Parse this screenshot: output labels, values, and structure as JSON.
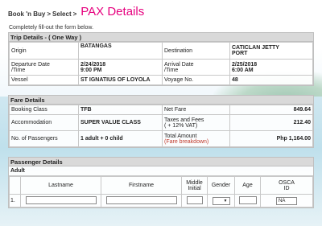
{
  "breadcrumb": {
    "step1": "Book 'n Buy",
    "sep": ">",
    "step2": "Select",
    "current": "PAX Details"
  },
  "instruction": "Completely fill-out the form below.",
  "trip": {
    "header": "Trip Details - ( One Way )",
    "origin_label": "Origin",
    "origin": "BATANGAS",
    "destination_label": "Destination",
    "destination_line1": "CATICLAN JETTY",
    "destination_line2": "PORT",
    "departure_label_1": "Departure Date",
    "departure_label_2": "/Time",
    "departure_date": "2/24/2018",
    "departure_time": "9:00 PM",
    "arrival_label_1": "Arrival Date",
    "arrival_label_2": "/Time",
    "arrival_date": "2/25/2018",
    "arrival_time": "6:00 AM",
    "vessel_label": "Vessel",
    "vessel": "ST IGNATIUS OF LOYOLA",
    "voyage_label": "Voyage No.",
    "voyage": "48"
  },
  "fare": {
    "header": "Fare Details",
    "booking_class_label": "Booking Class",
    "booking_class": "TFB",
    "net_fare_label": "Net Fare",
    "net_fare": "849.64",
    "accommodation_label": "Accommodation",
    "accommodation": "SUPER VALUE CLASS",
    "taxes_label_1": "Taxes and Fees",
    "taxes_label_2": "( + 12% VAT)",
    "taxes": "212.40",
    "passengers_label": "No. of Passengers",
    "passengers": "1 adult + 0 child",
    "total_label": "Total Amount",
    "breakdown_link": "(Fare breakdown)",
    "total": "Php 1,164.00"
  },
  "passenger": {
    "header": "Passenger Details",
    "group": "Adult",
    "columns": {
      "lastname": "Lastname",
      "firstname": "Firstname",
      "middle_1": "Middle",
      "middle_2": "Initial",
      "gender": "Gender",
      "age": "Age",
      "osca_1": "OSCA",
      "osca_2": "ID"
    },
    "row_number": "1.",
    "gender_value": "",
    "osca_value": "NA"
  },
  "colors": {
    "accent": "#e6007e",
    "link_red": "#c0392b",
    "header_gray": "#d9d9d9"
  }
}
